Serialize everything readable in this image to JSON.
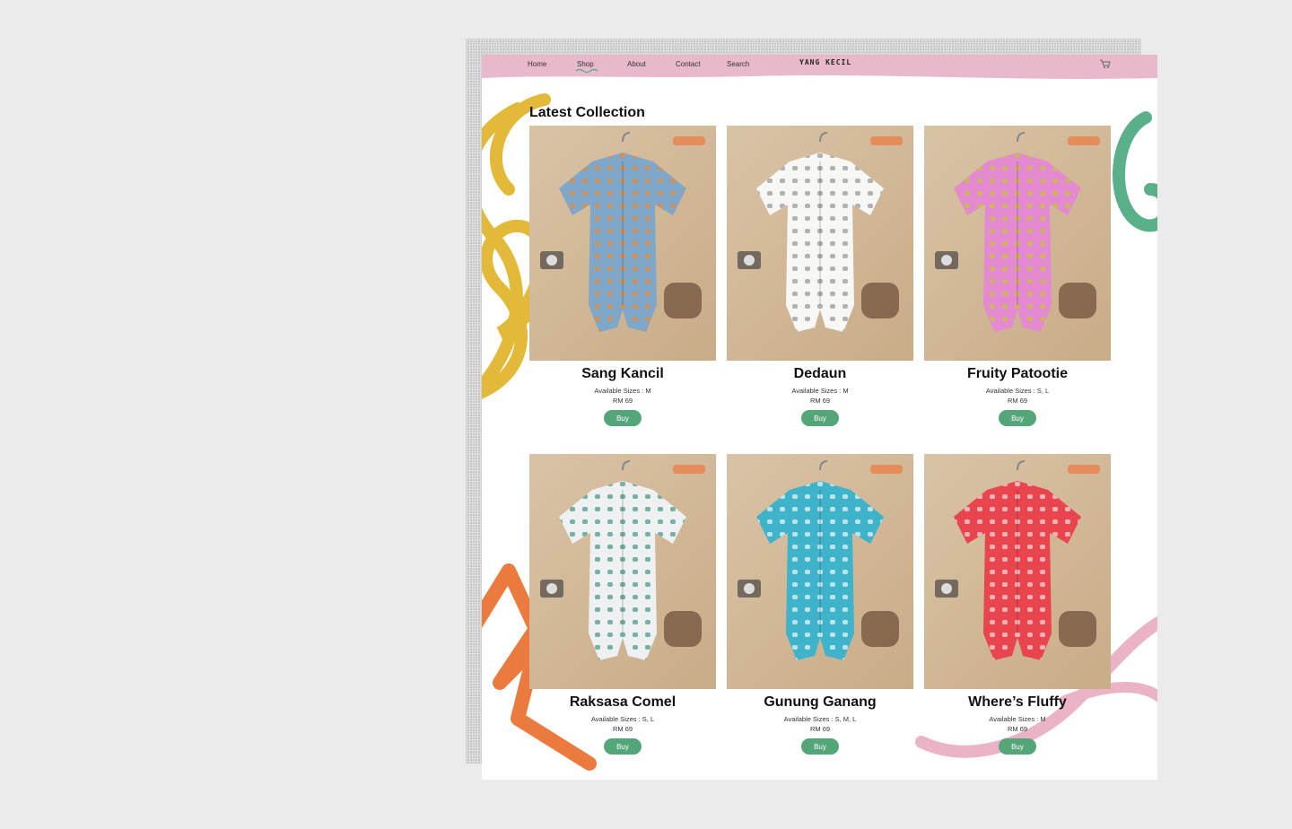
{
  "nav": {
    "links": [
      "Home",
      "Shop",
      "About",
      "Contact",
      "Search"
    ],
    "active": "Shop",
    "brand": "YANG KECIL",
    "cart_icon": "cart-icon"
  },
  "section": {
    "title": "Latest Collection"
  },
  "products": [
    {
      "name": "Sang Kancil",
      "sizes": "Available Sizes : M",
      "price": "RM 69",
      "buy": "Buy",
      "shirt_color": "#7fa7c9",
      "pattern_color": "#e58b3a"
    },
    {
      "name": "Dedaun",
      "sizes": "Available Sizes : M",
      "price": "RM 69",
      "buy": "Buy",
      "shirt_color": "#f7f7f5",
      "pattern_color": "#9a9a9a"
    },
    {
      "name": "Fruity Patootie",
      "sizes": "Available Sizes : S, L",
      "price": "RM 69",
      "buy": "Buy",
      "shirt_color": "#e48ad0",
      "pattern_color": "#c8c23a"
    },
    {
      "name": "Raksasa Comel",
      "sizes": "Available Sizes : S, L",
      "price": "RM 69",
      "buy": "Buy",
      "shirt_color": "#eef0f2",
      "pattern_color": "#4f9a8a"
    },
    {
      "name": "Gunung Ganang",
      "sizes": "Available Sizes : S, M, L",
      "price": "RM 69",
      "buy": "Buy",
      "shirt_color": "#3fb3c9",
      "pattern_color": "#e6f4f6"
    },
    {
      "name": "Where’s Fluffy",
      "sizes": "Available Sizes : M",
      "price": "RM 69",
      "buy": "Buy",
      "shirt_color": "#e8454f",
      "pattern_color": "#f6d6d6"
    }
  ],
  "colors": {
    "nav_band": "#e8b9cb",
    "accent_green": "#55a57a",
    "deco_yellow": "#e3b93a",
    "deco_orange": "#ea7a3e",
    "deco_pink": "#ebb3c6",
    "deco_green": "#5ab08a"
  }
}
